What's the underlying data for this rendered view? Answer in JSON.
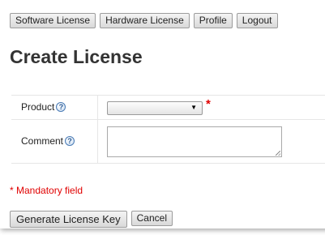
{
  "nav": {
    "software_license": "Software License",
    "hardware_license": "Hardware License",
    "profile": "Profile",
    "logout": "Logout"
  },
  "page": {
    "title": "Create License"
  },
  "form": {
    "product_label": "Product",
    "product_value": "",
    "required_marker": "*",
    "comment_label": "Comment",
    "comment_value": "",
    "help_glyph": "?",
    "mandatory_note": "* Mandatory field"
  },
  "actions": {
    "generate_label": "Generate License Key",
    "cancel_label": "Cancel"
  },
  "colors": {
    "required": "#e00000",
    "help_icon": "#4a7bb5"
  },
  "icons": {
    "help": "help-icon",
    "dropdown": "chevron-down-icon",
    "resize": "resize-grip-icon"
  }
}
